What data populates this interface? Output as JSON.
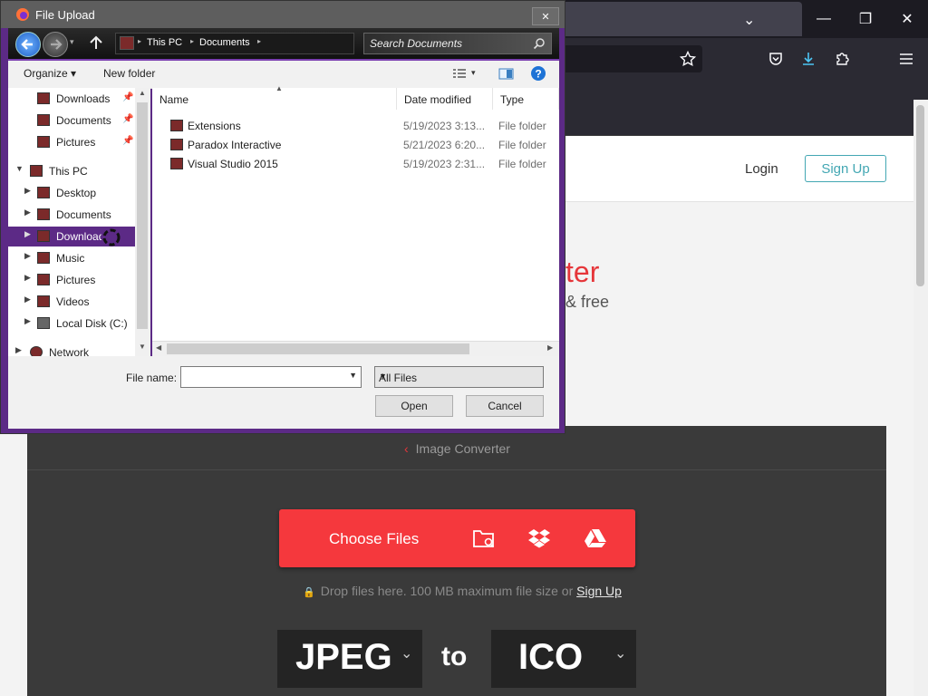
{
  "browser": {
    "tab_chevron": "⌄",
    "win_min": "—",
    "win_max": "❐",
    "win_close": "✕"
  },
  "site": {
    "login": "Login",
    "signup_button": "Sign Up",
    "hero_title_partial": "ter",
    "hero_sub_partial": "& free",
    "breadcrumb": "Image Converter",
    "choose_files": "Choose Files",
    "drop_text": "Drop files here. 100 MB maximum file size or",
    "drop_signup": "Sign Up",
    "from_format": "JPEG",
    "to_label": "to",
    "to_format": "ICO",
    "accent_color": "#f5383d"
  },
  "dialog": {
    "title": "File Upload",
    "close": "✕",
    "breadcrumb": [
      "This PC",
      "Documents"
    ],
    "search_placeholder": "Search Documents",
    "organize": "Organize ▾",
    "new_folder": "New folder",
    "nav": [
      {
        "label": "Downloads",
        "pinned": true
      },
      {
        "label": "Documents",
        "pinned": true
      },
      {
        "label": "Pictures",
        "pinned": true
      },
      {
        "label": "This PC"
      },
      {
        "label": "Desktop"
      },
      {
        "label": "Documents"
      },
      {
        "label": "Downloads",
        "selected": true
      },
      {
        "label": "Music"
      },
      {
        "label": "Pictures"
      },
      {
        "label": "Videos"
      },
      {
        "label": "Local Disk (C:)"
      },
      {
        "label": "Network"
      }
    ],
    "columns": {
      "name": "Name",
      "date": "Date modified",
      "type": "Type"
    },
    "files": [
      {
        "name": "Extensions",
        "date": "5/19/2023 3:13...",
        "type": "File folder"
      },
      {
        "name": "Paradox Interactive",
        "date": "5/21/2023 6:20...",
        "type": "File folder"
      },
      {
        "name": "Visual Studio 2015",
        "date": "5/19/2023 2:31...",
        "type": "File folder"
      }
    ],
    "file_name_label": "File name:",
    "file_name_value": "",
    "filter": "All Files",
    "open": "Open",
    "cancel": "Cancel"
  }
}
